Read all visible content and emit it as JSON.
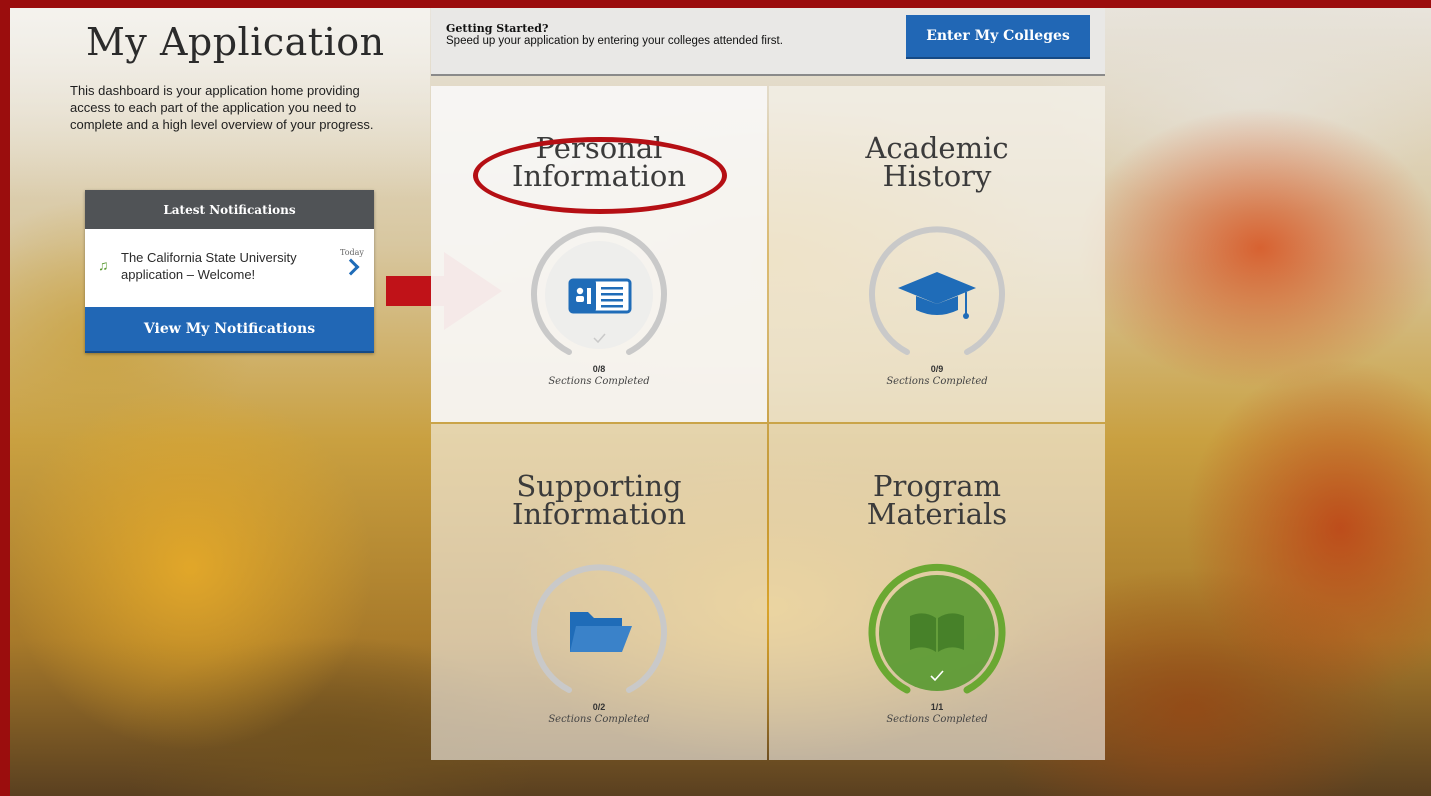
{
  "page": {
    "title": "My Application",
    "intro": "This dashboard is your application home providing access to each part of the application you need to complete and a high level overview of your progress."
  },
  "notifications": {
    "header": "Latest Notifications",
    "items": [
      {
        "text": "The California State University application – Welcome!",
        "time": "Today"
      }
    ],
    "button_label": "View My Notifications"
  },
  "getting_started": {
    "title": "Getting Started?",
    "text": "Speed up your application by entering your colleges attended first.",
    "button_label": "Enter My Colleges"
  },
  "tiles": [
    {
      "title": "Personal\nInformation",
      "count": "0/8",
      "label": "Sections Completed",
      "icon": "id-card-icon",
      "progress": 0
    },
    {
      "title": "Academic\nHistory",
      "count": "0/9",
      "label": "Sections Completed",
      "icon": "graduation-cap-icon",
      "progress": 0
    },
    {
      "title": "Supporting\nInformation",
      "count": "0/2",
      "label": "Sections Completed",
      "icon": "folder-icon",
      "progress": 0
    },
    {
      "title": "Program\nMaterials",
      "count": "1/1",
      "label": "Sections Completed",
      "icon": "book-icon",
      "progress": 1
    }
  ],
  "colors": {
    "frame": "#9b0d0d",
    "primary_button": "#2167b5",
    "complete_green": "#5a9a32",
    "highlight": "#b50f14"
  }
}
